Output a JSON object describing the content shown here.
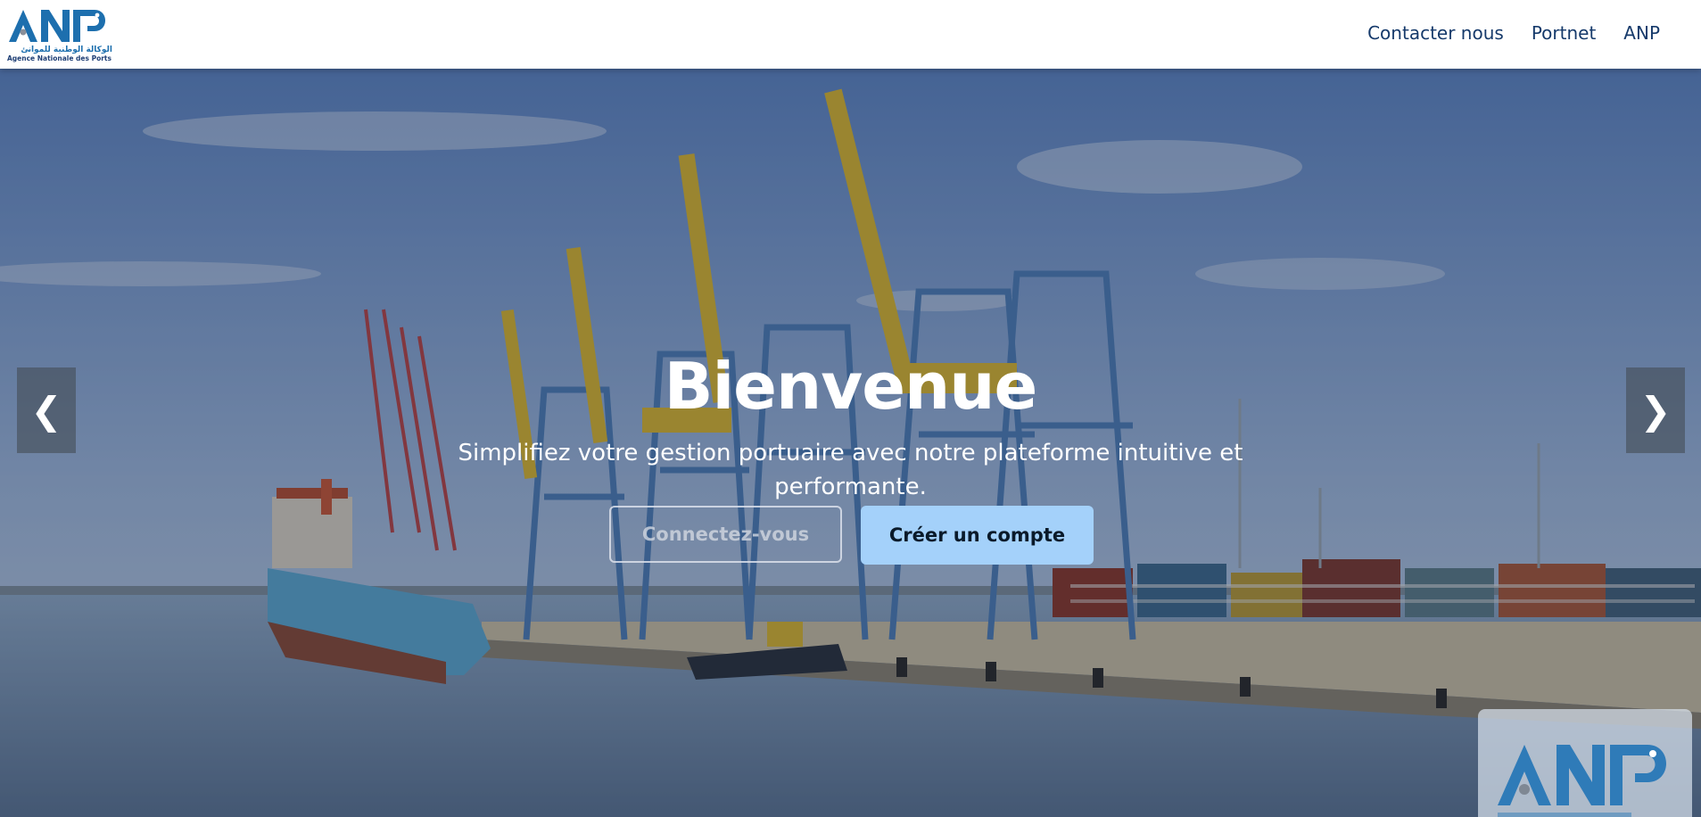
{
  "brand": {
    "logo_text": "ANP",
    "arabic_name": "الوكالة الوطنية للموانئ",
    "french_name": "Agence Nationale des Ports"
  },
  "nav": {
    "items": [
      {
        "label": "Contacter nous"
      },
      {
        "label": "Portnet"
      },
      {
        "label": "ANP"
      }
    ]
  },
  "hero": {
    "title": "Bienvenue",
    "subtitle": "Simplifiez votre gestion portuaire avec notre plateforme intuitive et performante.",
    "login_button": "Connectez-vous",
    "create_button": "Créer un compte",
    "prev_icon": "❮",
    "next_icon": "❯"
  },
  "colors": {
    "brand_blue": "#1d6fae",
    "nav_text": "#163a6b",
    "create_button_bg": "#a4d1fa"
  },
  "icons": {
    "prev": "chevron-left-icon",
    "next": "chevron-right-icon"
  }
}
